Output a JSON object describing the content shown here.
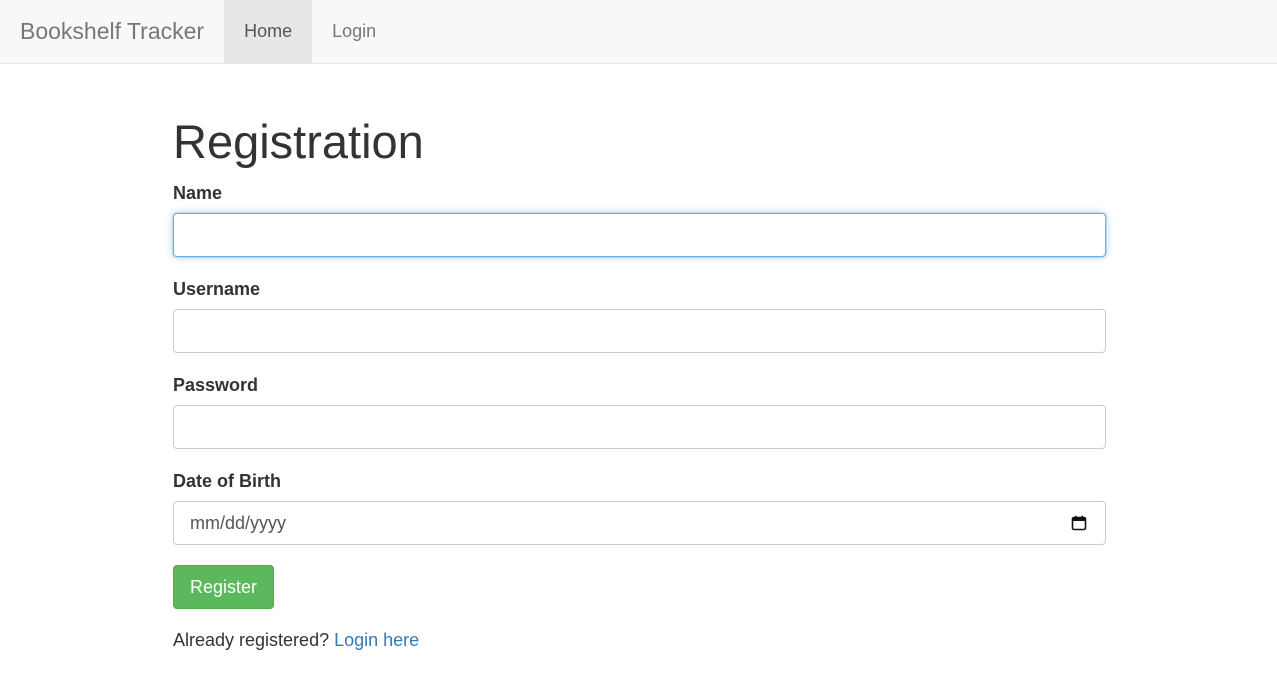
{
  "navbar": {
    "brand": "Bookshelf Tracker",
    "items": [
      {
        "label": "Home",
        "active": true
      },
      {
        "label": "Login",
        "active": false
      }
    ]
  },
  "page": {
    "title": "Registration"
  },
  "form": {
    "name": {
      "label": "Name",
      "value": "",
      "focused": true
    },
    "username": {
      "label": "Username",
      "value": ""
    },
    "password": {
      "label": "Password",
      "value": ""
    },
    "dob": {
      "label": "Date of Birth",
      "placeholder": "mm/dd/yyyy",
      "icon": "calendar-icon"
    },
    "submit_label": "Register"
  },
  "footer": {
    "prompt": "Already registered?",
    "link_label": "Login here"
  },
  "colors": {
    "navbar_bg": "#f8f8f8",
    "active_tab_bg": "#e7e7e7",
    "register_button": "#5cb85c",
    "link": "#337ab7",
    "focus_border": "#66afe9"
  }
}
